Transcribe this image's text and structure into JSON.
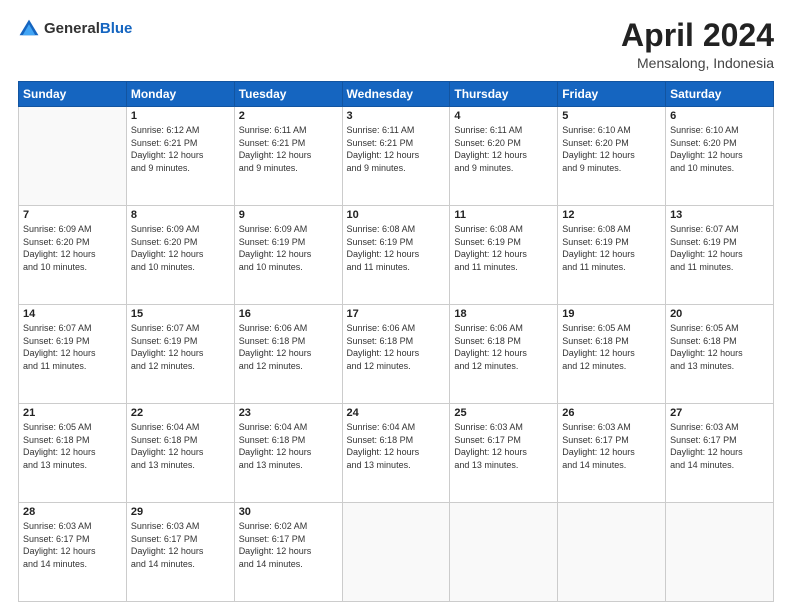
{
  "header": {
    "logo_line1": "General",
    "logo_line2": "Blue",
    "title": "April 2024",
    "subtitle": "Mensalong, Indonesia"
  },
  "calendar": {
    "days_of_week": [
      "Sunday",
      "Monday",
      "Tuesday",
      "Wednesday",
      "Thursday",
      "Friday",
      "Saturday"
    ],
    "weeks": [
      [
        {
          "day": "",
          "empty": true
        },
        {
          "day": "1",
          "sunrise": "6:12 AM",
          "sunset": "6:21 PM",
          "daylight": "12 hours and 9 minutes."
        },
        {
          "day": "2",
          "sunrise": "6:11 AM",
          "sunset": "6:21 PM",
          "daylight": "12 hours and 9 minutes."
        },
        {
          "day": "3",
          "sunrise": "6:11 AM",
          "sunset": "6:21 PM",
          "daylight": "12 hours and 9 minutes."
        },
        {
          "day": "4",
          "sunrise": "6:11 AM",
          "sunset": "6:20 PM",
          "daylight": "12 hours and 9 minutes."
        },
        {
          "day": "5",
          "sunrise": "6:10 AM",
          "sunset": "6:20 PM",
          "daylight": "12 hours and 9 minutes."
        },
        {
          "day": "6",
          "sunrise": "6:10 AM",
          "sunset": "6:20 PM",
          "daylight": "12 hours and 10 minutes."
        }
      ],
      [
        {
          "day": "7",
          "sunrise": "6:09 AM",
          "sunset": "6:20 PM",
          "daylight": "12 hours and 10 minutes."
        },
        {
          "day": "8",
          "sunrise": "6:09 AM",
          "sunset": "6:20 PM",
          "daylight": "12 hours and 10 minutes."
        },
        {
          "day": "9",
          "sunrise": "6:09 AM",
          "sunset": "6:19 PM",
          "daylight": "12 hours and 10 minutes."
        },
        {
          "day": "10",
          "sunrise": "6:08 AM",
          "sunset": "6:19 PM",
          "daylight": "12 hours and 11 minutes."
        },
        {
          "day": "11",
          "sunrise": "6:08 AM",
          "sunset": "6:19 PM",
          "daylight": "12 hours and 11 minutes."
        },
        {
          "day": "12",
          "sunrise": "6:08 AM",
          "sunset": "6:19 PM",
          "daylight": "12 hours and 11 minutes."
        },
        {
          "day": "13",
          "sunrise": "6:07 AM",
          "sunset": "6:19 PM",
          "daylight": "12 hours and 11 minutes."
        }
      ],
      [
        {
          "day": "14",
          "sunrise": "6:07 AM",
          "sunset": "6:19 PM",
          "daylight": "12 hours and 11 minutes."
        },
        {
          "day": "15",
          "sunrise": "6:07 AM",
          "sunset": "6:19 PM",
          "daylight": "12 hours and 12 minutes."
        },
        {
          "day": "16",
          "sunrise": "6:06 AM",
          "sunset": "6:18 PM",
          "daylight": "12 hours and 12 minutes."
        },
        {
          "day": "17",
          "sunrise": "6:06 AM",
          "sunset": "6:18 PM",
          "daylight": "12 hours and 12 minutes."
        },
        {
          "day": "18",
          "sunrise": "6:06 AM",
          "sunset": "6:18 PM",
          "daylight": "12 hours and 12 minutes."
        },
        {
          "day": "19",
          "sunrise": "6:05 AM",
          "sunset": "6:18 PM",
          "daylight": "12 hours and 12 minutes."
        },
        {
          "day": "20",
          "sunrise": "6:05 AM",
          "sunset": "6:18 PM",
          "daylight": "12 hours and 13 minutes."
        }
      ],
      [
        {
          "day": "21",
          "sunrise": "6:05 AM",
          "sunset": "6:18 PM",
          "daylight": "12 hours and 13 minutes."
        },
        {
          "day": "22",
          "sunrise": "6:04 AM",
          "sunset": "6:18 PM",
          "daylight": "12 hours and 13 minutes."
        },
        {
          "day": "23",
          "sunrise": "6:04 AM",
          "sunset": "6:18 PM",
          "daylight": "12 hours and 13 minutes."
        },
        {
          "day": "24",
          "sunrise": "6:04 AM",
          "sunset": "6:18 PM",
          "daylight": "12 hours and 13 minutes."
        },
        {
          "day": "25",
          "sunrise": "6:03 AM",
          "sunset": "6:17 PM",
          "daylight": "12 hours and 13 minutes."
        },
        {
          "day": "26",
          "sunrise": "6:03 AM",
          "sunset": "6:17 PM",
          "daylight": "12 hours and 14 minutes."
        },
        {
          "day": "27",
          "sunrise": "6:03 AM",
          "sunset": "6:17 PM",
          "daylight": "12 hours and 14 minutes."
        }
      ],
      [
        {
          "day": "28",
          "sunrise": "6:03 AM",
          "sunset": "6:17 PM",
          "daylight": "12 hours and 14 minutes."
        },
        {
          "day": "29",
          "sunrise": "6:03 AM",
          "sunset": "6:17 PM",
          "daylight": "12 hours and 14 minutes."
        },
        {
          "day": "30",
          "sunrise": "6:02 AM",
          "sunset": "6:17 PM",
          "daylight": "12 hours and 14 minutes."
        },
        {
          "day": "",
          "empty": true
        },
        {
          "day": "",
          "empty": true
        },
        {
          "day": "",
          "empty": true
        },
        {
          "day": "",
          "empty": true
        }
      ]
    ]
  }
}
